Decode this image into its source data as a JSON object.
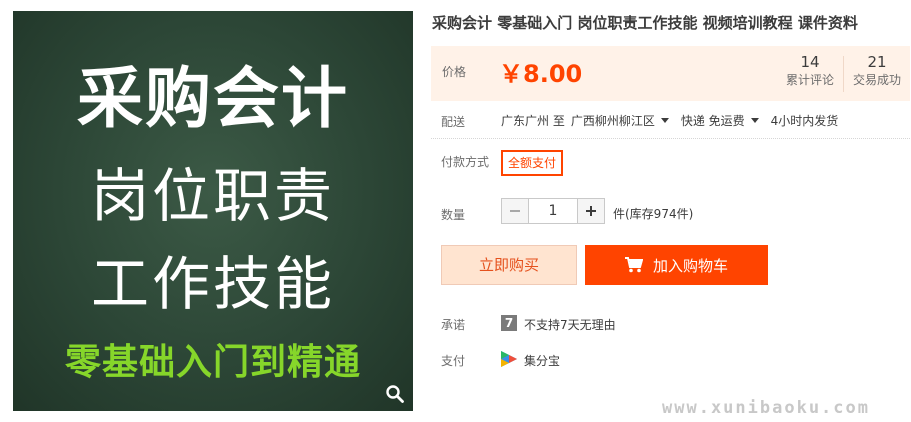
{
  "product_image": {
    "line1": "采购会计",
    "line2": "岗位职责",
    "line3": "工作技能",
    "line4": "零基础入门到精通",
    "zoom_icon": "magnifier-icon"
  },
  "title": "采购会计 零基础入门 岗位职责工作技能 视频培训教程 课件资料",
  "price": {
    "label": "价格",
    "value": "￥8.00",
    "reviews_count": "14",
    "reviews_label": "累计评论",
    "deals_count": "21",
    "deals_label": "交易成功"
  },
  "delivery": {
    "label": "配送",
    "from": "广东广州 至",
    "to": "广西柳州柳江区",
    "shipping": "快递 免运费",
    "dispatch": "4小时内发货"
  },
  "payment_method": {
    "label": "付款方式",
    "option": "全额支付"
  },
  "quantity": {
    "label": "数量",
    "value": "1",
    "stock": "件(库存974件)"
  },
  "actions": {
    "buy_now": "立即购买",
    "add_cart": "加入购物车",
    "cart_icon": "shopping-cart-icon"
  },
  "promise": {
    "label": "承诺",
    "icon_text": "7",
    "text": "不支持7天无理由"
  },
  "pay": {
    "label": "支付",
    "text": "集分宝"
  },
  "watermark": "www.xunibaoku.com",
  "colors": {
    "accent": "#ff4400",
    "price_bg": "#fff2e8",
    "board_green": "#2c4636",
    "board_highlight": "#86d62a"
  }
}
